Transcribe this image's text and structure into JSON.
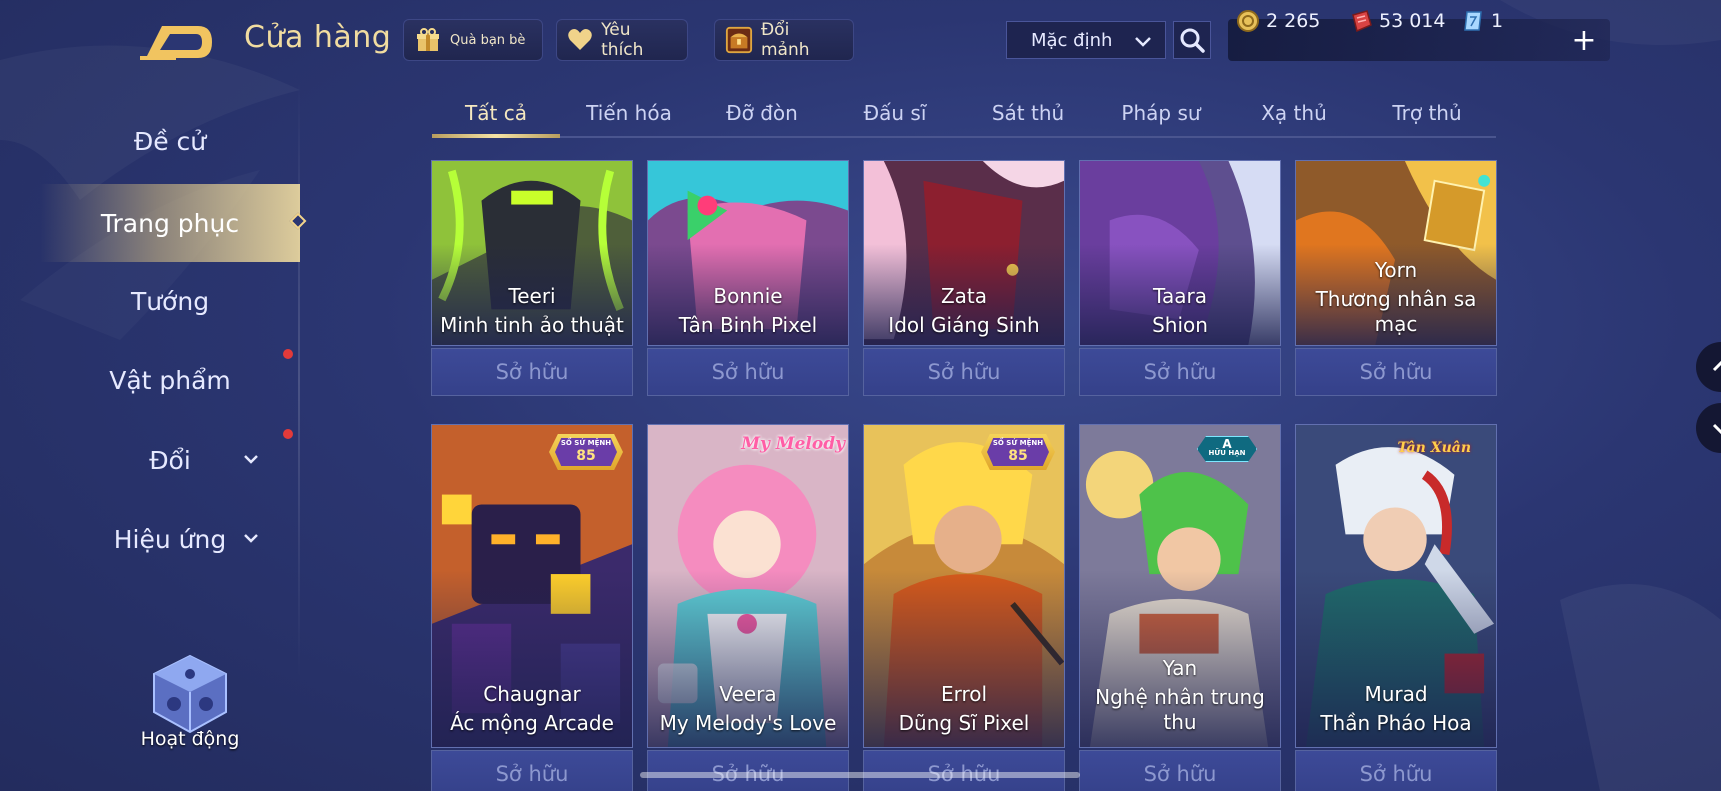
{
  "header": {
    "title": "Cửa hàng",
    "gift_label": "Quà bạn bè",
    "favorite_label": "Yêu thích",
    "exchange_label": "Đổi mảnh",
    "sort_value": "Mặc định",
    "currencies": {
      "gold": "2 265",
      "voucher": "53 014",
      "gem": "1"
    },
    "add_symbol": "+"
  },
  "sidebar": {
    "items": [
      {
        "label": "Đề cử"
      },
      {
        "label": "Trang phục"
      },
      {
        "label": "Tướng"
      },
      {
        "label": "Vật phẩm"
      },
      {
        "label": "Đổi"
      },
      {
        "label": "Hiệu ứng"
      }
    ],
    "active_index": 1,
    "activity_label": "Hoạt động"
  },
  "tabs": [
    "Tất cả",
    "Tiến hóa",
    "Đỡ đòn",
    "Đấu sĩ",
    "Sát thủ",
    "Pháp sư",
    "Xạ thủ",
    "Trợ thủ"
  ],
  "active_tab": 0,
  "cards": [
    {
      "hero": "Teeri",
      "skin": "Minh tinh ảo thuật",
      "status": "Sở hữu",
      "art": "teeri",
      "badge": ""
    },
    {
      "hero": "Bonnie",
      "skin": "Tân Binh Pixel",
      "status": "Sở hữu",
      "art": "bonnie",
      "badge": ""
    },
    {
      "hero": "Zata",
      "skin": "Idol Giáng Sinh",
      "status": "Sở hữu",
      "art": "zata",
      "badge": ""
    },
    {
      "hero": "Taara",
      "skin": "Shion",
      "status": "Sở hữu",
      "art": "taara",
      "badge": ""
    },
    {
      "hero": "Yorn",
      "skin": "Thương nhân sa mạc",
      "status": "Sở hữu",
      "art": "yorn",
      "badge": ""
    },
    {
      "hero": "Chaugnar",
      "skin": "Ác mộng Arcade",
      "status": "Sở hữu",
      "art": "chaugnar",
      "badge": "mission85"
    },
    {
      "hero": "Veera",
      "skin": "My Melody's Love",
      "status": "Sở hữu",
      "art": "veera",
      "badge": "mymelody"
    },
    {
      "hero": "Errol",
      "skin": "Dũng Sĩ Pixel",
      "status": "Sở hữu",
      "art": "errol",
      "badge": "mission85"
    },
    {
      "hero": "Yan",
      "skin": "Nghệ nhân trung thu",
      "status": "Sở hữu",
      "art": "yan",
      "badge": "limited"
    },
    {
      "hero": "Murad",
      "skin": "Thần Pháo Hoa",
      "status": "Sở hữu",
      "art": "murad",
      "badge": "tanxuan"
    }
  ],
  "badges": {
    "mission85": {
      "line1": "SỔ SỨ MỆNH",
      "line2": "85"
    },
    "mymelody": {
      "text": "My Melody"
    },
    "limited": {
      "line1": "A",
      "line2": "HỮU HẠN"
    },
    "tanxuan": {
      "text": "Tân Xuân"
    }
  },
  "colors": {
    "accent_gold": "#f1dca0",
    "background": "#2b3672",
    "card_button": "#3d4a98",
    "notification": "#e23a3a"
  },
  "icons": {
    "back": "back-arrow-icon",
    "gift": "gift-icon",
    "favorite": "heart-icon",
    "exchange": "treasure-chest-icon",
    "search": "search-icon",
    "gold": "gold-coin-icon",
    "voucher": "voucher-icon",
    "gem": "gem-icon",
    "scroll_up": "chevron-up-icon",
    "scroll_down": "chevron-down-icon"
  }
}
